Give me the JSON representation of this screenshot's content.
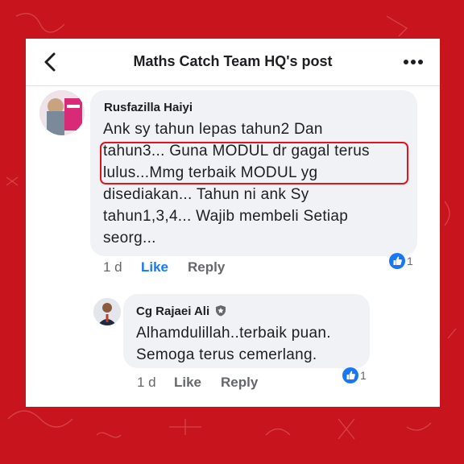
{
  "header": {
    "title": "Maths Catch Team HQ's post"
  },
  "comments": [
    {
      "author": "Rusfazilla Haiyi",
      "text": "Ank sy tahun lepas tahun2 Dan\ntahun3... Guna MODUL dr gagal terus\nlulus...Mmg terbaik MODUL yg\ndisediakan... Tahun ni ank Sy\ntahun1,3,4... Wajib membeli Setiap\nseorg...",
      "time": "1 d",
      "like_label": "Like",
      "reply_label": "Reply",
      "reaction_count": "1"
    },
    {
      "author": "Cg Rajaei Ali",
      "text": "Alhamdulillah..terbaik puan.\nSemoga terus cemerlang.",
      "time": "1 d",
      "like_label": "Like",
      "reply_label": "Reply",
      "reaction_count": "1"
    }
  ],
  "icons": {
    "back": "chevron-left-icon",
    "more": "more-horizontal-icon",
    "reaction": "thumbs-up-icon",
    "badge": "shield-badge-icon"
  },
  "colors": {
    "background": "#c8141c",
    "accent": "#1877f2",
    "highlight": "#e0141e"
  }
}
